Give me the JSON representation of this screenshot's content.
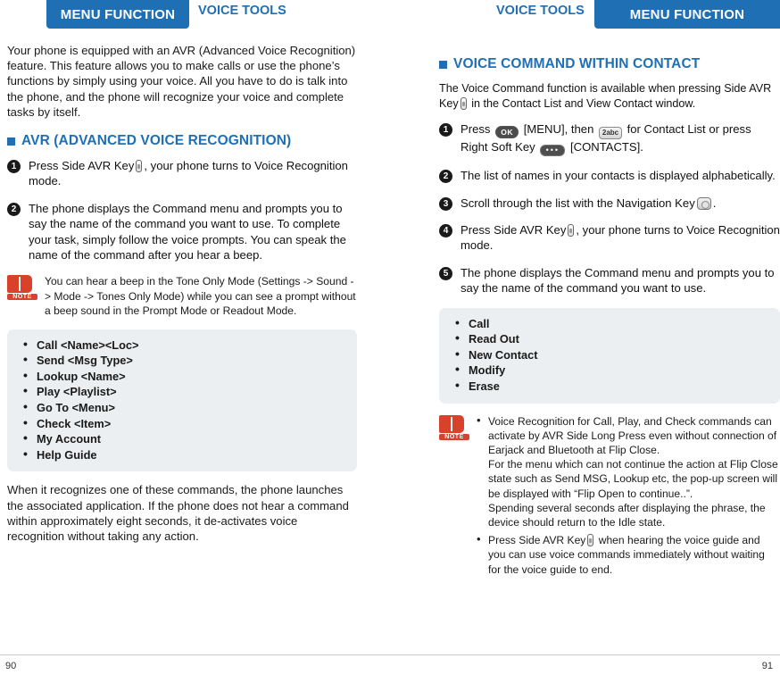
{
  "header": {
    "left_tab": "MENU FUNCTION",
    "left_label": "VOICE TOOLS",
    "right_label": "VOICE TOOLS",
    "right_tab": "MENU FUNCTION"
  },
  "left_page": {
    "intro": "Your phone is equipped with an AVR (Advanced Voice Recognition) feature. This feature allows you to make calls or use the phone’s functions by simply using your voice. All you have to do is talk into the phone, and the phone will recognize your voice and complete tasks by itself.",
    "section_title": "AVR (ADVANCED VOICE RECOGNITION)",
    "steps": [
      {
        "num": "1",
        "pre": "Press Side AVR Key",
        "post": ", your phone turns to Voice Recognition mode."
      },
      {
        "num": "2",
        "pre": "The phone displays the Command menu and prompts you to say the name of the command you want to use. To complete your task, simply follow the voice prompts. You can speak the name of the command after you hear a beep.",
        "post": ""
      }
    ],
    "note": "You can hear a beep in the Tone Only Mode (Settings -> Sound -> Mode -> Tones Only Mode) while you can see a prompt without a beep sound in the Prompt Mode or Readout Mode.",
    "note_label": "NOTE",
    "commands": [
      "Call <Name><Loc>",
      "Send <Msg Type>",
      "Lookup <Name>",
      "Play <Playlist>",
      "Go To <Menu>",
      "Check <Item>",
      "My Account",
      "Help Guide"
    ],
    "closing": "When it recognizes one of these commands, the phone launches the associated application. If the phone does not hear a command within approximately eight seconds, it de-activates voice recognition without taking any action.",
    "page_number": "90"
  },
  "right_page": {
    "section_title": "VOICE COMMAND WITHIN CONTACT",
    "lead_pre": "The Voice Command function is available when pressing Side AVR Key",
    "lead_post": "in the Contact List and View Contact window.",
    "steps": [
      {
        "num": "1",
        "part1": "Press",
        "key_ok": "OK",
        "part2": "[MENU], then",
        "key_2": "2",
        "key_2_sub": "abc",
        "part3": "for Contact List or press Right Soft Key",
        "key_soft": "•••",
        "part4": "[CONTACTS]."
      },
      {
        "num": "2",
        "text": "The list of names in your contacts is displayed alphabetically."
      },
      {
        "num": "3",
        "text_pre": "Scroll through the list with the Navigation Key",
        "text_post": "."
      },
      {
        "num": "4",
        "text_pre": "Press Side AVR Key",
        "text_post": ", your phone turns to Voice Recognition mode."
      },
      {
        "num": "5",
        "text": "The phone displays the Command menu and prompts you to say the name of the command you want to use."
      }
    ],
    "commands": [
      "Call",
      "Read Out",
      "New Contact",
      "Modify",
      "Erase"
    ],
    "note_label": "NOTE",
    "note_bullets": [
      "Voice Recognition for Call, Play, and Check commands can activate by AVR Side Long Press even without connection of Earjack and Bluetooth at Flip Close.\nFor the menu which can not continue the action at Flip Close state such as Send MSG, Lookup etc, the pop-up screen will be displayed with “Flip Open to continue..”.\nSpending several seconds after displaying the phrase, the device should return to the Idle state.",
      "Press Side AVR Key     when hearing the voice guide and you can use voice commands immediately without waiting for the voice guide to end."
    ],
    "note_b2_pre": "Press Side AVR Key",
    "note_b2_post": "when hearing the voice guide and you can use voice commands immediately without waiting for the voice guide to end.",
    "page_number": "91"
  },
  "colors": {
    "accent": "#1f6fb5",
    "note_red": "#d8422a",
    "box_grey": "#eceff1"
  }
}
